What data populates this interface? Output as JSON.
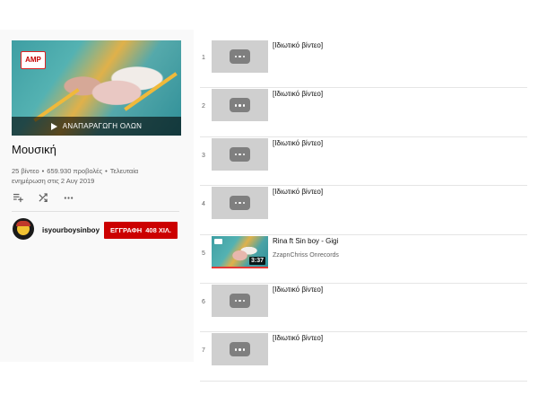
{
  "playlist": {
    "play_all_label": "ΑΝΑΠΑΡΑΓΩΓΗ ΟΛΩΝ",
    "title": "Μουσική",
    "video_count": "25 βίντεο",
    "views": "659.930 προβολές",
    "updated": "Τελευταία ενημέρωση στις 2 Αυγ 2019",
    "thumbnail_logo": "AMP"
  },
  "channel": {
    "name": "isyourboysinboy",
    "subscribe_label": "ΕΓΓΡΑΦΗ",
    "subscriber_count": "408 ΧΙΛ."
  },
  "colors": {
    "subscribe": "#cc0000",
    "progress": "#e53935"
  },
  "icons": [
    "play-icon",
    "add-to-queue-icon",
    "shuffle-icon",
    "more-icon",
    "more-horiz-icon"
  ],
  "videos": [
    {
      "index": "1",
      "title": "[Ιδιωτικό βίντεο]"
    },
    {
      "index": "2",
      "title": "[Ιδιωτικό βίντεο]"
    },
    {
      "index": "3",
      "title": "[Ιδιωτικό βίντεο]"
    },
    {
      "index": "4",
      "title": "[Ιδιωτικό βίντεο]"
    },
    {
      "index": "5",
      "title": "Rina ft Sin boy - Gigi",
      "channel": "ZzapnChriss Onrecords",
      "duration": "3:37"
    },
    {
      "index": "6",
      "title": "[Ιδιωτικό βίντεο]"
    },
    {
      "index": "7",
      "title": "[Ιδιωτικό βίντεο]"
    }
  ]
}
